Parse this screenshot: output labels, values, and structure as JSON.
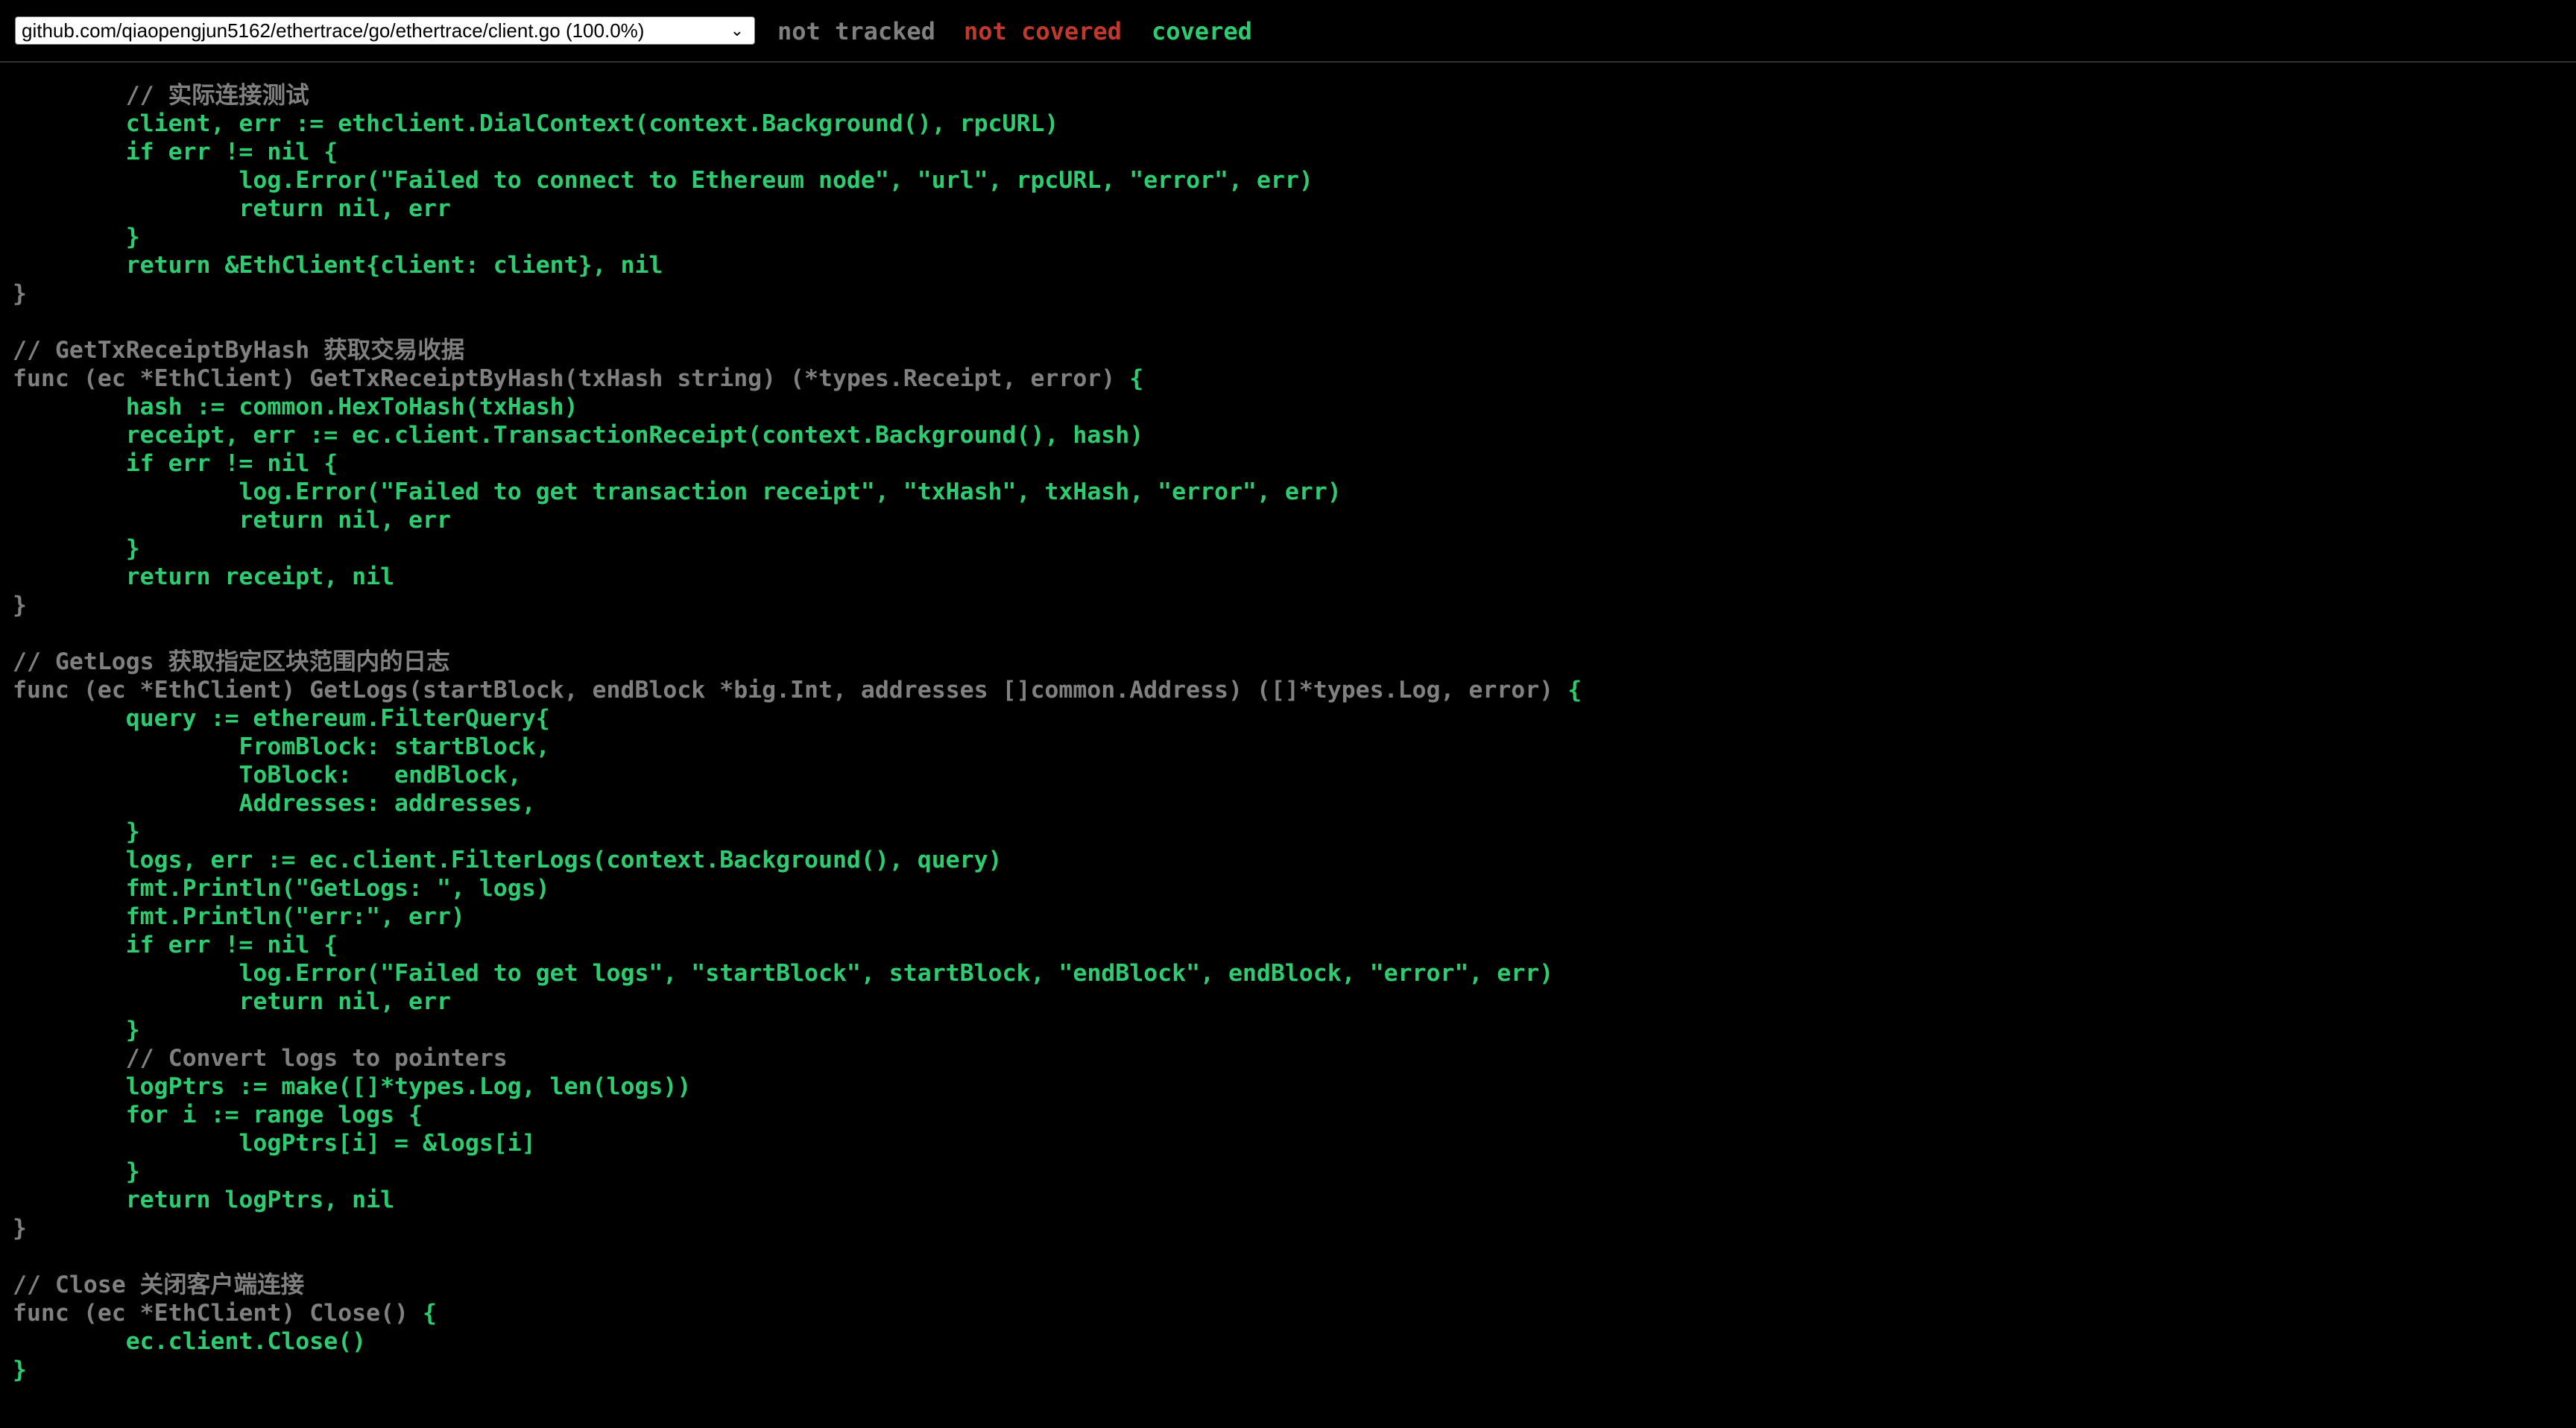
{
  "toolbar": {
    "file_select": {
      "selected": "github.com/qiaopengjun5162/ethertrace/go/ethertrace/client.go (100.0%)",
      "icon": "chevron-down-icon"
    },
    "legend": {
      "not_tracked": "not tracked",
      "not_covered": "not covered",
      "covered": "covered"
    }
  },
  "colors": {
    "background": "#000000",
    "not_tracked": "#808080",
    "not_covered": "#c0392b",
    "covered": "#2ecc71"
  },
  "code": {
    "lines": [
      {
        "text": "\t// 实际连接测试",
        "status": "not-tracked"
      },
      {
        "text": "\tclient, err := ethclient.DialContext(context.Background(), rpcURL)",
        "status": "covered"
      },
      {
        "text": "\tif err != nil {",
        "status": "covered"
      },
      {
        "text": "\t\tlog.Error(\"Failed to connect to Ethereum node\", \"url\", rpcURL, \"error\", err)",
        "status": "covered"
      },
      {
        "text": "\t\treturn nil, err",
        "status": "covered"
      },
      {
        "text": "\t}",
        "status": "covered"
      },
      {
        "text": "\treturn &EthClient{client: client}, nil",
        "status": "covered"
      },
      {
        "text": "}",
        "status": "not-tracked"
      },
      {
        "text": "",
        "status": "not-tracked"
      },
      {
        "text": "// GetTxReceiptByHash 获取交易收据",
        "status": "not-tracked"
      },
      {
        "text": "func (ec *EthClient) GetTxReceiptByHash(txHash string) (*types.Receipt, error) ",
        "tail": "{",
        "status": "not-tracked"
      },
      {
        "text": "\thash := common.HexToHash(txHash)",
        "status": "covered"
      },
      {
        "text": "\treceipt, err := ec.client.TransactionReceipt(context.Background(), hash)",
        "status": "covered"
      },
      {
        "text": "\tif err != nil {",
        "status": "covered"
      },
      {
        "text": "\t\tlog.Error(\"Failed to get transaction receipt\", \"txHash\", txHash, \"error\", err)",
        "status": "covered"
      },
      {
        "text": "\t\treturn nil, err",
        "status": "covered"
      },
      {
        "text": "\t}",
        "status": "covered"
      },
      {
        "text": "\treturn receipt, nil",
        "status": "covered"
      },
      {
        "text": "}",
        "status": "not-tracked"
      },
      {
        "text": "",
        "status": "not-tracked"
      },
      {
        "text": "// GetLogs 获取指定区块范围内的日志",
        "status": "not-tracked"
      },
      {
        "text": "func (ec *EthClient) GetLogs(startBlock, endBlock *big.Int, addresses []common.Address) ([]*types.Log, error) ",
        "tail": "{",
        "status": "not-tracked"
      },
      {
        "text": "\tquery := ethereum.FilterQuery{",
        "status": "covered"
      },
      {
        "text": "\t\tFromBlock: startBlock,",
        "status": "covered"
      },
      {
        "text": "\t\tToBlock:   endBlock,",
        "status": "covered"
      },
      {
        "text": "\t\tAddresses: addresses,",
        "status": "covered"
      },
      {
        "text": "\t}",
        "status": "covered"
      },
      {
        "text": "\tlogs, err := ec.client.FilterLogs(context.Background(), query)",
        "status": "covered"
      },
      {
        "text": "\tfmt.Println(\"GetLogs: \", logs)",
        "status": "covered"
      },
      {
        "text": "\tfmt.Println(\"err:\", err)",
        "status": "covered"
      },
      {
        "text": "\tif err != nil {",
        "status": "covered"
      },
      {
        "text": "\t\tlog.Error(\"Failed to get logs\", \"startBlock\", startBlock, \"endBlock\", endBlock, \"error\", err)",
        "status": "covered"
      },
      {
        "text": "\t\treturn nil, err",
        "status": "covered"
      },
      {
        "text": "\t}",
        "status": "covered"
      },
      {
        "text": "\t// Convert logs to pointers",
        "status": "not-tracked"
      },
      {
        "text": "\tlogPtrs := make([]*types.Log, len(logs))",
        "status": "covered"
      },
      {
        "text": "\tfor i := range logs {",
        "status": "covered"
      },
      {
        "text": "\t\tlogPtrs[i] = &logs[i]",
        "status": "covered"
      },
      {
        "text": "\t}",
        "status": "covered"
      },
      {
        "text": "\treturn logPtrs, nil",
        "status": "covered"
      },
      {
        "text": "}",
        "status": "not-tracked"
      },
      {
        "text": "",
        "status": "not-tracked"
      },
      {
        "text": "// Close 关闭客户端连接",
        "status": "not-tracked"
      },
      {
        "text": "func (ec *EthClient) Close() ",
        "tail": "{",
        "status": "not-tracked"
      },
      {
        "text": "\tec.client.Close()",
        "status": "covered"
      },
      {
        "text": "}",
        "status": "covered"
      }
    ]
  }
}
